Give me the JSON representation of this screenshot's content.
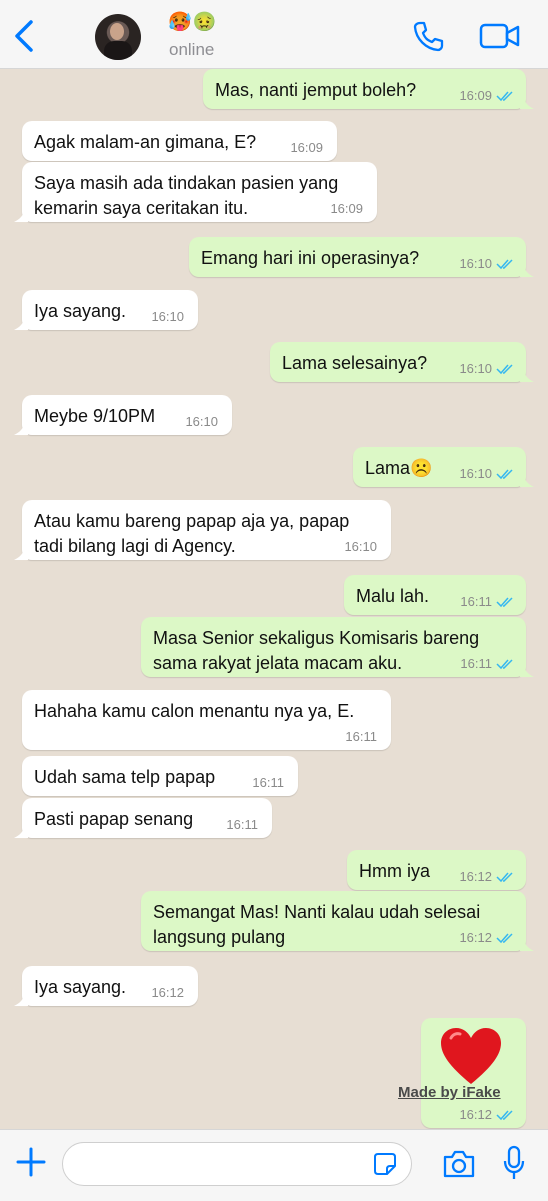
{
  "header": {
    "back_icon": "chevron-left-icon",
    "contact_emoji": "🥵🤢",
    "status": "online",
    "call_icon": "phone-icon",
    "video_icon": "video-camera-icon",
    "accent": "#007aff"
  },
  "messages": [
    {
      "text": "Mas, nanti jemput boleh?",
      "time": "16:09"
    },
    {
      "text": "Agak malam-an gimana, E?",
      "time": "16:09"
    },
    {
      "line1": "Saya masih ada tindakan pasien yang",
      "line2": "kemarin saya ceritakan itu.",
      "time": "16:09"
    },
    {
      "text": "Emang hari ini operasinya?",
      "time": "16:10"
    },
    {
      "text": "Iya sayang.",
      "time": "16:10"
    },
    {
      "text": "Lama selesainya?",
      "time": "16:10"
    },
    {
      "text": "Meybe 9/10PM",
      "time": "16:10"
    },
    {
      "text": "Lama☹️",
      "time": "16:10"
    },
    {
      "line1": "Atau kamu bareng papap aja ya, papap",
      "line2": "tadi bilang lagi di Agency.",
      "time": "16:10"
    },
    {
      "text": "Malu lah.",
      "time": "16:11"
    },
    {
      "line1": "Masa Senior sekaligus Komisaris bareng",
      "line2": "sama rakyat jelata macam aku.",
      "time": "16:11"
    },
    {
      "line1": "Hahaha kamu calon menantu nya ya, E.",
      "time": "16:11"
    },
    {
      "text": "Udah sama telp papap",
      "time": "16:11"
    },
    {
      "text": "Pasti papap senang",
      "time": "16:11"
    },
    {
      "text": "Hmm iya",
      "time": "16:12"
    },
    {
      "line1": "Semangat Mas! Nanti kalau udah selesai",
      "line2": "langsung pulang",
      "time": "16:12"
    },
    {
      "text": "Iya sayang.",
      "time": "16:12"
    },
    {
      "sticker": "heart-icon",
      "time": "16:12"
    }
  ],
  "watermark": "Made by iFake",
  "colors": {
    "outgoing": "#dcf8c6",
    "incoming": "#ffffff",
    "ticks": "#34b7f1"
  },
  "input": {
    "value": "",
    "plus_icon": "plus-icon",
    "sticker_icon": "sticker-icon",
    "camera_icon": "camera-icon",
    "mic_icon": "microphone-icon"
  }
}
